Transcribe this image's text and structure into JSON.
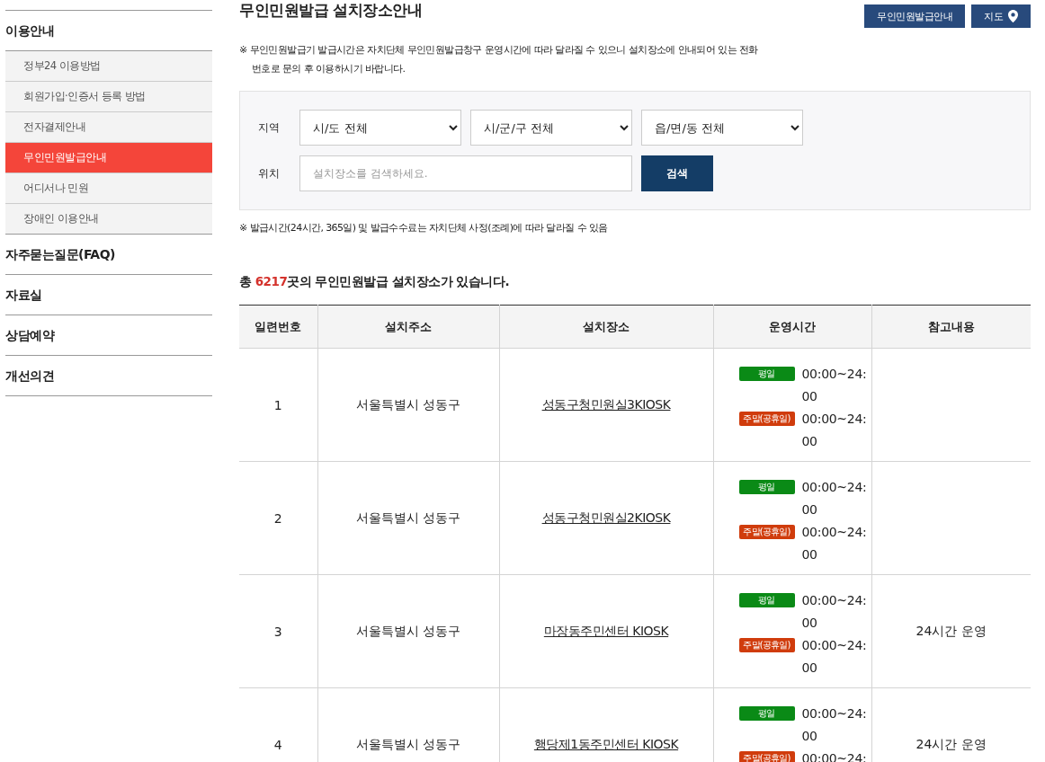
{
  "sidebar": {
    "sections": [
      {
        "label": "이용안내",
        "children": [
          {
            "label": "정부24 이용방법",
            "selected": false
          },
          {
            "label": "회원가입·인증서 등록 방법",
            "selected": false
          },
          {
            "label": "전자결제안내",
            "selected": false
          },
          {
            "label": "무인민원발급안내",
            "selected": true
          },
          {
            "label": "어디서나 민원",
            "selected": false
          },
          {
            "label": "장애인 이용안내",
            "selected": false
          }
        ]
      },
      {
        "label": "자주묻는질문(FAQ)"
      },
      {
        "label": "자료실"
      },
      {
        "label": "상담예약"
      },
      {
        "label": "개선의견"
      }
    ]
  },
  "page_title": "무인민원발급 설치장소안내",
  "header_buttons": [
    {
      "label": "무인민원발급안내",
      "kind": "text"
    },
    {
      "label": "지도",
      "kind": "map"
    }
  ],
  "notice": "※ 무인민원발급기 발급시간은 자치단체 무인민원발급창구 운영시간에 따라 달라질 수 있으니 설치장소에 안내되어 있는 전화번호로 문의 후 이용하시기 바랍니다.",
  "search": {
    "region_label": "지역",
    "selects": [
      "시/도 전체",
      "시/군/구 전체",
      "읍/면/동 전체"
    ],
    "location_label": "위치",
    "placeholder": "설치장소를 검색하세요.",
    "button": "검색"
  },
  "fee_note": "※ 발급시간(24시간, 365일) 및 발급수수료는 자치단체 사정(조례)에 따라 달라질 수 있음",
  "summary": {
    "prefix": "총 ",
    "count": "6217",
    "suffix": "곳의 무인민원발급 설치장소가 있습니다."
  },
  "table": {
    "columns": [
      "일련번호",
      "설치주소",
      "설치장소",
      "운영시간",
      "참고내용"
    ],
    "rows": [
      {
        "no": "1",
        "address": "서울특별시 성동구",
        "place": "성동구청민원실3KIOSK",
        "hours": [
          {
            "kind": "weekday",
            "label": "평일",
            "time": "00:00~24:00"
          },
          {
            "kind": "weekend",
            "label": "주말(공휴일)",
            "time": "00:00~24:00"
          }
        ]
      },
      {
        "no": "2",
        "address": "서울특별시 성동구",
        "place": "성동구청민원실2KIOSK",
        "hours": [
          {
            "kind": "weekday",
            "label": "평일",
            "time": "00:00~24:00"
          },
          {
            "kind": "weekend",
            "label": "주말(공휴일)",
            "time": "00:00~24:00"
          }
        ]
      },
      {
        "no": "3",
        "address": "서울특별시 성동구",
        "place": "마장동주민센터 KIOSK",
        "hours": [
          {
            "kind": "weekday",
            "label": "평일",
            "time": "00:00~24:00"
          },
          {
            "kind": "weekend",
            "label": "주말(공휴일)",
            "time": "00:00~24:00"
          }
        ],
        "note": "24시간 운영"
      },
      {
        "no": "4",
        "address": "서울특별시 성동구",
        "place": "행당제1동주민센터 KIOSK",
        "hours": [
          {
            "kind": "weekday",
            "label": "평일",
            "time": "00:00~24:00"
          },
          {
            "kind": "weekend",
            "label": "주말(공휴일)",
            "time": "00:00~24:"
          }
        ],
        "note": "24시간 운영"
      }
    ]
  }
}
